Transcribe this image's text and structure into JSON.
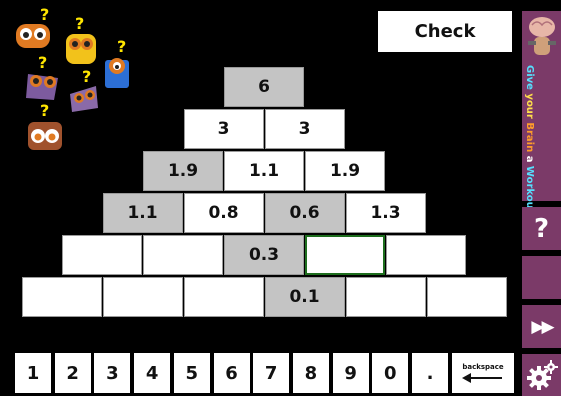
{
  "app": {
    "check_label": "Check",
    "promo": {
      "words": [
        {
          "text": "Give ",
          "color": "#55e0ff"
        },
        {
          "text": "your ",
          "color": "#ffe04a"
        },
        {
          "text": "Brain ",
          "color": "#ff9d2a"
        },
        {
          "text": "a ",
          "color": "#ffffff"
        },
        {
          "text": "Workout",
          "color": "#55e0ff"
        }
      ]
    },
    "help_label": "?",
    "skip_label": "▶▶",
    "backspace_label": "backspace"
  },
  "pyramid": {
    "rows": [
      {
        "cells": [
          {
            "value": "6",
            "given": true
          }
        ]
      },
      {
        "cells": [
          {
            "value": "3",
            "given": false
          },
          {
            "value": "3",
            "given": false
          }
        ]
      },
      {
        "cells": [
          {
            "value": "1.9",
            "given": true
          },
          {
            "value": "1.1",
            "given": false
          },
          {
            "value": "1.9",
            "given": false
          }
        ]
      },
      {
        "cells": [
          {
            "value": "1.1",
            "given": true
          },
          {
            "value": "0.8",
            "given": false
          },
          {
            "value": "0.6",
            "given": true
          },
          {
            "value": "1.3",
            "given": false
          }
        ]
      },
      {
        "cells": [
          {
            "value": "",
            "given": false
          },
          {
            "value": "",
            "given": false
          },
          {
            "value": "0.3",
            "given": true
          },
          {
            "value": "",
            "given": false,
            "selected": true
          },
          {
            "value": "",
            "given": false
          }
        ]
      },
      {
        "cells": [
          {
            "value": "",
            "given": false
          },
          {
            "value": "",
            "given": false
          },
          {
            "value": "",
            "given": false
          },
          {
            "value": "0.1",
            "given": true
          },
          {
            "value": "",
            "given": false
          },
          {
            "value": "",
            "given": false
          }
        ]
      }
    ]
  },
  "keypad": {
    "keys": [
      "1",
      "2",
      "3",
      "4",
      "5",
      "6",
      "7",
      "8",
      "9",
      "0",
      "."
    ]
  },
  "colors": {
    "given_cell": "#c4c4c4",
    "selected_border": "#1e6e1e",
    "sidebar": "#7b3a68",
    "question_mark": "#ffe600"
  }
}
